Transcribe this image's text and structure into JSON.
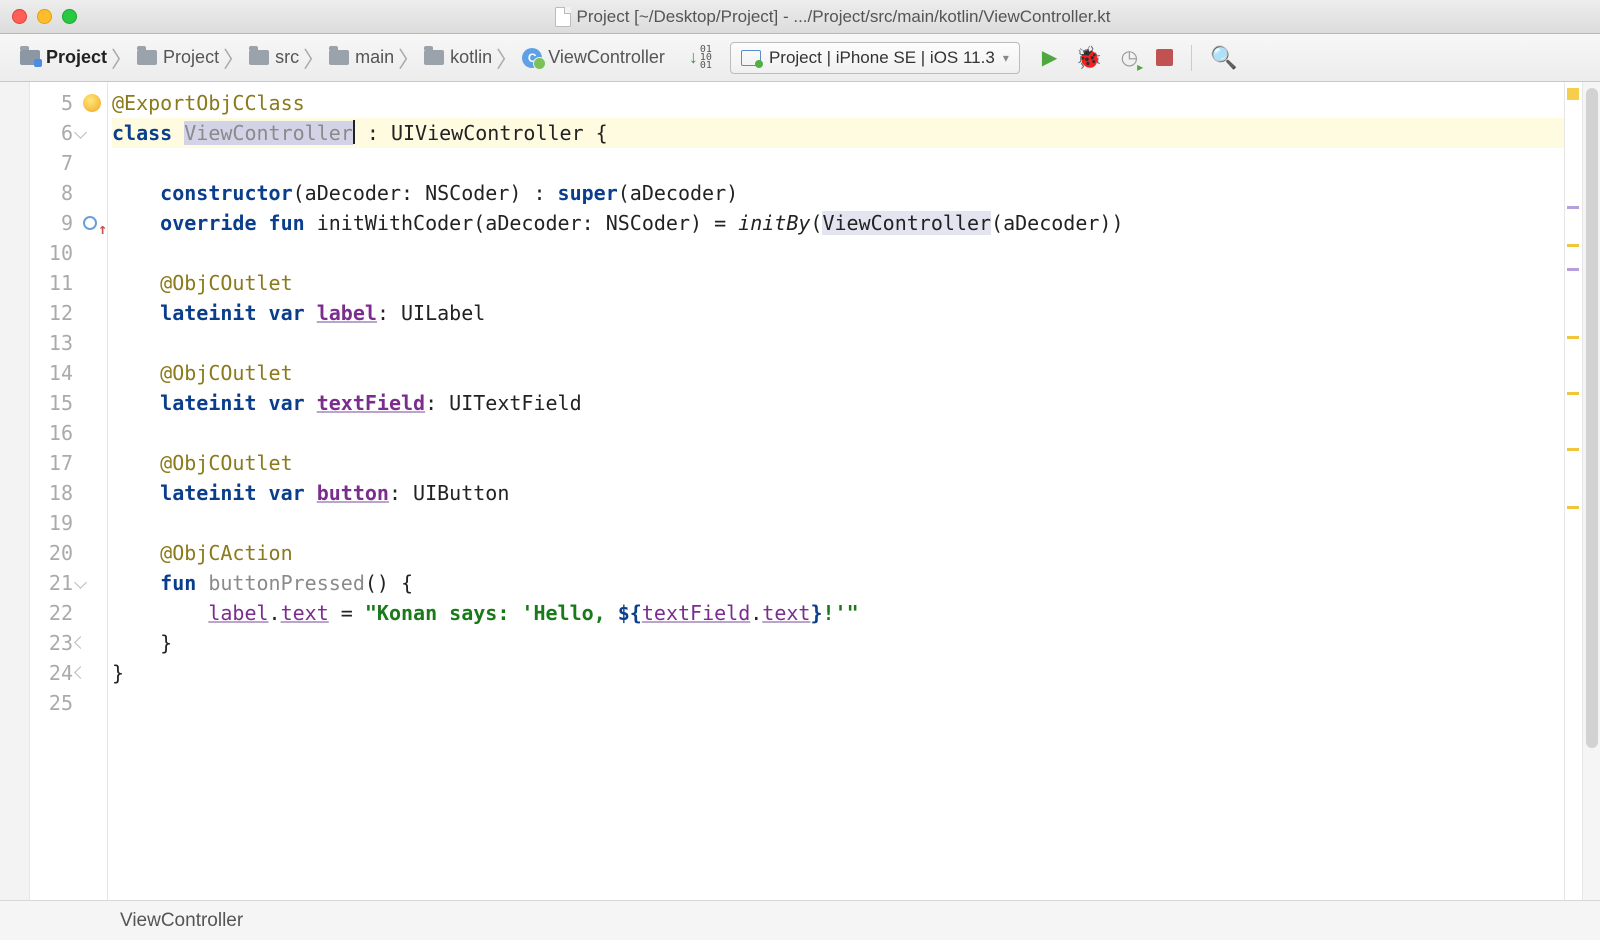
{
  "title": "Project [~/Desktop/Project] - .../Project/src/main/kotlin/ViewController.kt",
  "breadcrumbs": [
    "Project",
    "Project",
    "src",
    "main",
    "kotlin",
    "ViewController"
  ],
  "run_config": "Project | iPhone SE | iOS 11.3",
  "footer_crumb": "ViewController",
  "line_start": 5,
  "line_count": 21,
  "code": {
    "l5_ann": "@ExportObjCClass",
    "l6_class": "class",
    "l6_name": "ViewController",
    "l6_colon": " : UIViewController {",
    "l8_ctor": "constructor",
    "l8_rest": "(aDecoder: NSCoder) : ",
    "l8_super": "super",
    "l8_tail": "(aDecoder)",
    "l9_ov": "override",
    "l9_fun": "fun",
    "l9_name": " initWithCoder(aDecoder: NSCoder) = ",
    "l9_initby": "initBy",
    "l9_paren1": "(",
    "l9_vc": "ViewController",
    "l9_tail": "(aDecoder))",
    "l11_ann": "@ObjCOutlet",
    "l12_li": "lateinit",
    "l12_var": "var",
    "l12_label": "label",
    "l12_tail": ": UILabel",
    "l14_ann": "@ObjCOutlet",
    "l15_li": "lateinit",
    "l15_var": "var",
    "l15_tf": "textField",
    "l15_tail": ": UITextField",
    "l17_ann": "@ObjCOutlet",
    "l18_li": "lateinit",
    "l18_var": "var",
    "l18_btn": "button",
    "l18_tail": ": UIButton",
    "l20_ann": "@ObjCAction",
    "l21_fun": "fun",
    "l21_name": " buttonPressed() {",
    "l21_muted": "buttonPressed",
    "l22_label": "label",
    "l22_text1": "text",
    "l22_eq": " = ",
    "l22_str1": "\"Konan says: 'Hello, ",
    "l22_tpl_open": "${",
    "l22_tf": "textField",
    "l22_text2": "text",
    "l22_tpl_close": "}",
    "l22_str2": "!'\"",
    "l23": "    }",
    "l24": "}"
  }
}
